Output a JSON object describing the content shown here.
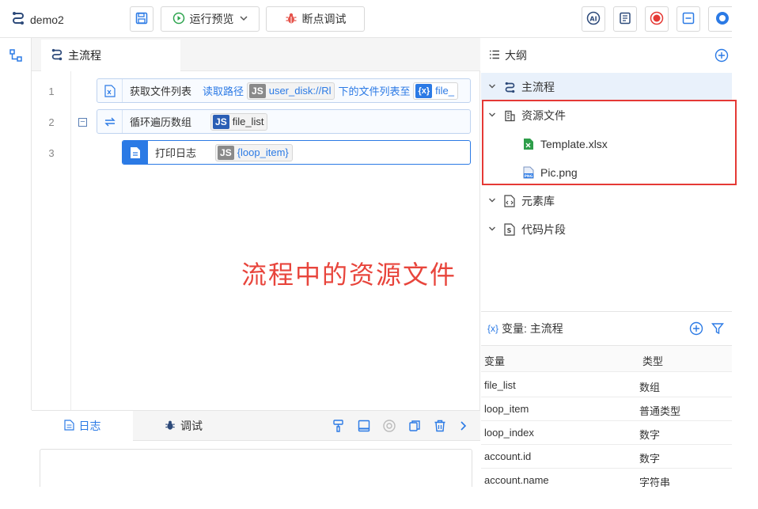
{
  "app": {
    "title": "demo2"
  },
  "toolbar": {
    "run_preview_label": "运行预览",
    "debug_label": "断点调试"
  },
  "editor": {
    "tab_label": "主流程",
    "lines": [
      "1",
      "2",
      "3"
    ],
    "node1": {
      "title": "获取文件列表",
      "prefix": "读取路径",
      "path_value": "user_disk://Rl",
      "suffix": "下的文件列表至",
      "var_value": "file_"
    },
    "node2": {
      "title": "循环遍历数组",
      "value": "file_list"
    },
    "node3": {
      "title": "打印日志",
      "value": "{loop_item}"
    },
    "js_tag": "JS",
    "var_tag": "{x}"
  },
  "annotation": "流程中的资源文件",
  "log": {
    "tab_log": "日志",
    "tab_debug": "调试"
  },
  "outline": {
    "title": "大纲",
    "items": {
      "main_flow": "主流程",
      "resources": "资源文件",
      "template": "Template.xlsx",
      "pic": "Pic.png",
      "elements": "元素库",
      "snippets": "代码片段"
    }
  },
  "variables": {
    "title": "变量: 主流程",
    "col_name": "变量",
    "col_type": "类型",
    "rows": [
      {
        "name": "file_list",
        "type": "数组"
      },
      {
        "name": "loop_item",
        "type": "普通类型"
      },
      {
        "name": "loop_index",
        "type": "数字"
      },
      {
        "name": "account.id",
        "type": "数字"
      },
      {
        "name": "account.name",
        "type": "字符串"
      }
    ]
  },
  "colors": {
    "accent": "#2b7ae5",
    "highlight_box": "#e53935",
    "annotation": "#e8453c"
  }
}
